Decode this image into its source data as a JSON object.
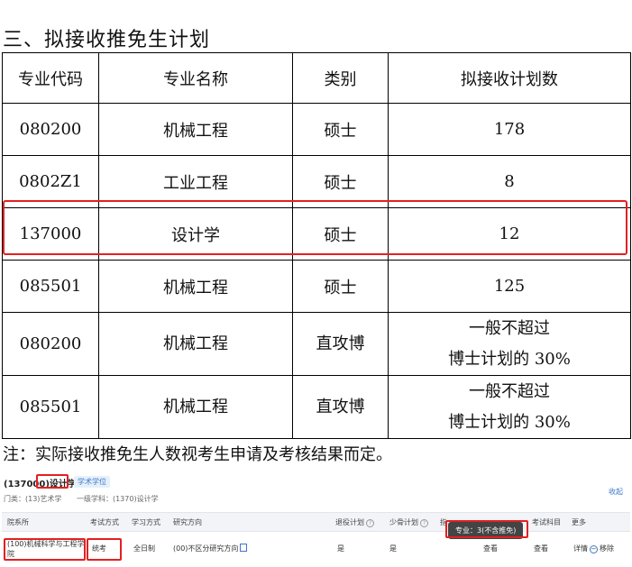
{
  "heading": "三、拟接收推免生计划",
  "table": {
    "headers": [
      "专业代码",
      "专业名称",
      "类别",
      "拟接收计划数"
    ],
    "rows": [
      {
        "code": "080200",
        "name": "机械工程",
        "type": "硕士",
        "plan": "178"
      },
      {
        "code": "0802Z1",
        "name": "工业工程",
        "type": "硕士",
        "plan": "8"
      },
      {
        "code": "137000",
        "name": "设计学",
        "type": "硕士",
        "plan": "12"
      },
      {
        "code": "085501",
        "name": "机械工程",
        "type": "硕士",
        "plan": "125"
      },
      {
        "code": "080200",
        "name": "机械工程",
        "type": "直攻博",
        "plan_line1": "一般不超过",
        "plan_line2": "博士计划的 30%"
      },
      {
        "code": "085501",
        "name": "机械工程",
        "type": "直攻博",
        "plan_line1": "一般不超过",
        "plan_line2": "博士计划的 30%"
      }
    ]
  },
  "note": "注：实际接收推免生人数视考生申请及考核结果而定。",
  "screenshot": {
    "title_code": "(137000)",
    "title_name": "设计学",
    "badge": "学术学位",
    "meta_category": "门类：(13)艺术学",
    "meta_discipline": "一级学科：(1370)设计学",
    "collapse": "收起",
    "headers": {
      "dept": "院系所",
      "exam_mode": "考试方式",
      "study_mode": "学习方式",
      "direction": "研究方向",
      "retired_plan": "退役计划",
      "minority_plan": "少骨计划",
      "supervisor": "指",
      "exam_subjects": "考试科目",
      "more": "更多"
    },
    "row": {
      "dept": "(100)机械科学与工程学院",
      "exam_mode": "统考",
      "study_mode": "全日制",
      "direction": "(00)不区分研究方向",
      "retired_plan": "是",
      "minority_plan": "是",
      "view1": "查看",
      "view2": "查看",
      "detail": "详情",
      "remove": "移除"
    },
    "tooltip": "专业：3(不含推免)",
    "accent_color": "#3c78c8",
    "highlight_color": "#e32020"
  }
}
